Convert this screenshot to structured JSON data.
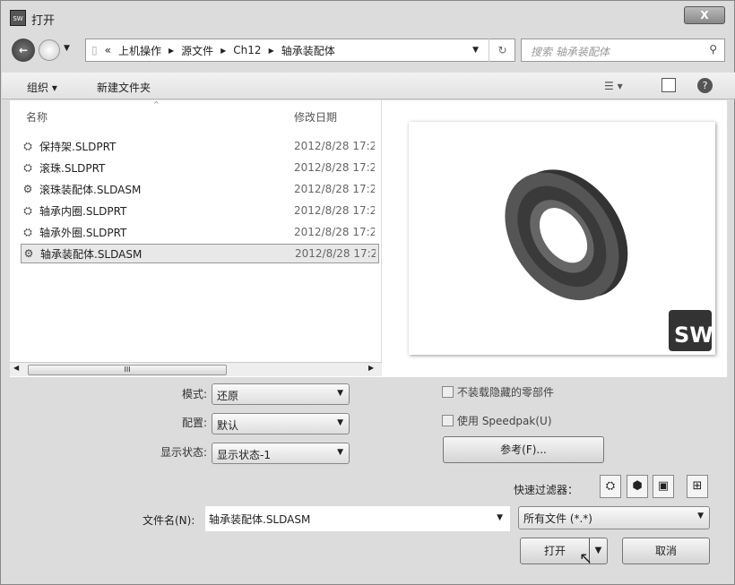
{
  "window": {
    "title": "打开",
    "app_icon_text": "2017"
  },
  "nav": {
    "breadcrumb": [
      "«",
      "上机操作",
      "源文件",
      "Ch12",
      "轴承装配体"
    ],
    "search_placeholder": "搜索 轴承装配体"
  },
  "toolbar": {
    "organize": "组织 ▾",
    "new_folder": "新建文件夹"
  },
  "list": {
    "columns": [
      "名称",
      "修改日期"
    ],
    "files": [
      {
        "name": "保持架.SLDPRT",
        "date": "2012/8/28 17:2",
        "icon": "part-icon"
      },
      {
        "name": "滚珠.SLDPRT",
        "date": "2012/8/28 17:2",
        "icon": "part-icon"
      },
      {
        "name": "滚珠装配体.SLDASM",
        "date": "2012/8/28 17:2",
        "icon": "assembly-icon"
      },
      {
        "name": "轴承内圈.SLDPRT",
        "date": "2012/8/28 17:2",
        "icon": "part-icon"
      },
      {
        "name": "轴承外圈.SLDPRT",
        "date": "2012/8/28 17:2",
        "icon": "part-icon"
      },
      {
        "name": "轴承装配体.SLDASM",
        "date": "2012/8/28 17:2",
        "icon": "assembly-icon",
        "selected": true
      }
    ],
    "scroll_thumb": "III"
  },
  "preview": {
    "logo": "SW"
  },
  "options": {
    "mode_label": "模式:",
    "mode_value": "还原",
    "config_label": "配置:",
    "config_value": "默认",
    "display_label": "显示状态:",
    "display_value": "显示状态-1",
    "no_hidden": "不装载隐藏的零部件",
    "speedpak": "使用 Speedpak(U)",
    "references": "参考(F)...",
    "quick_filter": "快速过滤器："
  },
  "footer": {
    "filename_label": "文件名(N):",
    "filename_value": "轴承装配体.SLDASM",
    "filetype": "所有文件 (*.*)",
    "open": "打开",
    "cancel": "取消"
  }
}
